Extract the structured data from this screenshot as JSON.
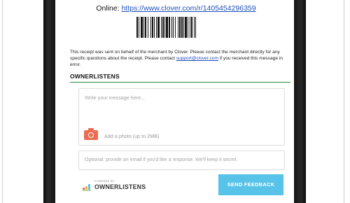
{
  "receipt": {
    "online_label": "Online:",
    "online_url": "https://www.clover.com/r/1405454296359",
    "notice_before": "This receipt was sent on behalf of the merchant by Clover. Please contact the merchant directly for any specific questions about the receipt. Please contact ",
    "support_email": "support@clover.com",
    "notice_after": " if you received this message in error."
  },
  "feedback": {
    "section_title": "OWNERLISTENS",
    "message_placeholder": "Write your message here...",
    "add_photo_label": "Add a photo (up to 2MB)",
    "email_placeholder": "Optional: provide an email if you'd like a response. We'll keep it secret.",
    "powered_by": "POWERED BY",
    "brand_name": "OWNERLISTENS",
    "send_button": "SEND FEEDBACK"
  },
  "colors": {
    "accent_rule": "#2e8b3e",
    "send_button": "#57c3e8",
    "camera_icon": "#ea6d52",
    "link": "#1f4fb8"
  },
  "icons": [
    "barcode-icon",
    "camera-icon",
    "ownerlistens-logo-icon"
  ]
}
